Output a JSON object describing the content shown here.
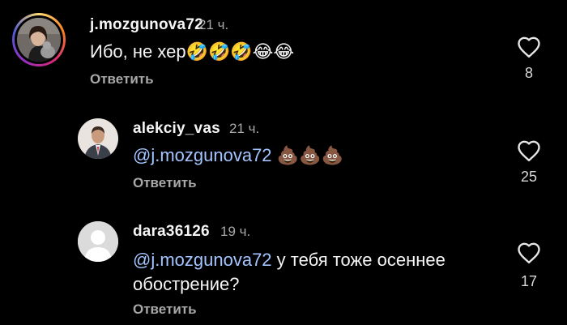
{
  "comments": [
    {
      "username": "j.mozgunova72",
      "time": "21 ч.",
      "text": "Ибо, не хер",
      "emojis": "🤣🤣🤣😂😂",
      "reply_label": "Ответить",
      "likes": "8"
    },
    {
      "username": "alekciy_vas",
      "time": "21 ч.",
      "mention": "@j.mozgunova72",
      "emojis": "💩💩💩",
      "reply_label": "Ответить",
      "likes": "25"
    },
    {
      "username": "dara36126",
      "time": "19 ч.",
      "mention": "@j.mozgunova72",
      "text_line1": " у тебя тоже осеннее",
      "text_line2": "обострение?",
      "reply_label": "Ответить",
      "likes": "17"
    }
  ],
  "colors": {
    "background": "#000000",
    "mention": "#a3c4ff",
    "secondary_text": "#a8a8a8"
  },
  "icons": {
    "like": "heart-outline-icon",
    "default_avatar": "default-user-avatar-icon"
  }
}
